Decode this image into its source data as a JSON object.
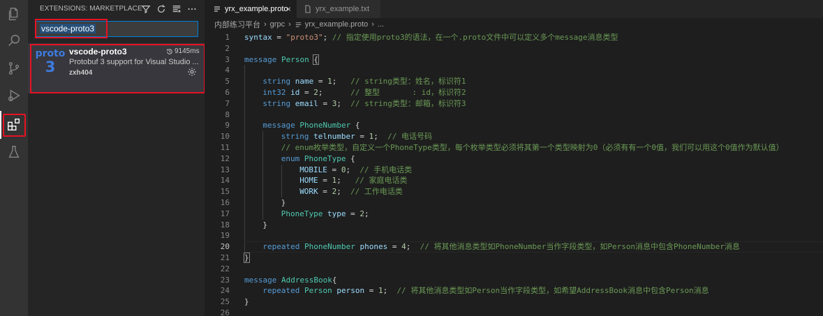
{
  "sidebar": {
    "title": "EXTENSIONS: MARKETPLACE",
    "search_value": "vscode-proto3",
    "extension": {
      "logo_line1": "proto",
      "logo_line2": "3",
      "name": "vscode-proto3",
      "installs": "9145ms",
      "description": "Protobuf 3 support for Visual Studio ...",
      "author": "zxh404"
    }
  },
  "tabs": [
    {
      "label": "yrx_example.proto",
      "close": "×"
    },
    {
      "label": "yrx_example.txt"
    }
  ],
  "breadcrumb": [
    "内部练习平台",
    "grpc",
    "yrx_example.proto",
    "..."
  ],
  "code": {
    "current_line": 20,
    "lines": [
      {
        "n": "1"
      },
      {
        "n": "2"
      },
      {
        "n": "3"
      },
      {
        "n": "4"
      },
      {
        "n": "5"
      },
      {
        "n": "6"
      },
      {
        "n": "7"
      },
      {
        "n": "8"
      },
      {
        "n": "9"
      },
      {
        "n": "10"
      },
      {
        "n": "11"
      },
      {
        "n": "12"
      },
      {
        "n": "13"
      },
      {
        "n": "14"
      },
      {
        "n": "15"
      },
      {
        "n": "16"
      },
      {
        "n": "17"
      },
      {
        "n": "18"
      },
      {
        "n": "19"
      },
      {
        "n": "20"
      },
      {
        "n": "21"
      },
      {
        "n": "22"
      },
      {
        "n": "23"
      },
      {
        "n": "24"
      },
      {
        "n": "25"
      },
      {
        "n": "26"
      }
    ],
    "tokens": {
      "l1": [
        "syntax",
        " = ",
        "\"proto3\"",
        "; ",
        "// 指定使用proto3的语法，在一个.proto文件中可以定义多个message消息类型"
      ],
      "l3": [
        "message",
        " ",
        "Person",
        " ",
        "{"
      ],
      "l5": [
        "string",
        " ",
        "name",
        " = ",
        "1",
        ";   ",
        "// string类型：姓名，标识符1"
      ],
      "l6": [
        "int32",
        " ",
        "id",
        " = ",
        "2",
        ";      ",
        "// 整型       : id，标识符2"
      ],
      "l7": [
        "string",
        " ",
        "email",
        " = ",
        "3",
        ";  ",
        "// string类型：邮箱，标识符3"
      ],
      "l9": [
        "message",
        " ",
        "PhoneNumber",
        " {"
      ],
      "l10": [
        "string",
        " ",
        "telnumber",
        " = ",
        "1",
        ";  ",
        "// 电话号码"
      ],
      "l11": [
        "// enum枚举类型，自定义一个PhoneType类型，每个枚举类型必须将其第一个类型映射为0（必须有有一个0值，我们可以用这个0值作为默认值）"
      ],
      "l12": [
        "enum",
        " ",
        "PhoneType",
        " {"
      ],
      "l13": [
        "MOBILE",
        " = ",
        "0",
        ";  ",
        "// 手机电话类"
      ],
      "l14": [
        "HOME",
        " = ",
        "1",
        ";   ",
        "// 家庭电话类"
      ],
      "l15": [
        "WORK",
        " = ",
        "2",
        ";  ",
        "// 工作电话类"
      ],
      "l16": [
        "}"
      ],
      "l17": [
        "PhoneType",
        " ",
        "type",
        " = ",
        "2",
        ";"
      ],
      "l18": [
        "}"
      ],
      "l20": [
        "repeated",
        " ",
        "PhoneNumber",
        " ",
        "phones",
        " = ",
        "4",
        ";  ",
        "// 将其他消息类型如PhoneNumber当作字段类型，如Person消息中包含PhoneNumber消息"
      ],
      "l21": [
        "}"
      ],
      "l23": [
        "message",
        " ",
        "AddressBook",
        "{"
      ],
      "l24": [
        "repeated",
        " ",
        "Person",
        " ",
        "person",
        " = ",
        "1",
        ";  ",
        "// 将其他消息类型如Person当作字段类型，如希望AddressBook消息中包含Person消息"
      ],
      "l25": [
        "}"
      ]
    }
  },
  "colors": {
    "keyword": "#569cd6",
    "type": "#4ec9b0",
    "variable": "#9cdcfe",
    "number": "#b5cea8",
    "string": "#ce9178",
    "comment": "#6a9955",
    "highlight_box": "#e81123"
  },
  "icons": {
    "activity": [
      "files-icon",
      "search-icon",
      "source-control-icon",
      "run-debug-icon",
      "extensions-icon",
      "testing-flask-icon"
    ],
    "sidebar_actions": [
      "filter-icon",
      "refresh-icon",
      "clear-icon",
      "more-icon"
    ]
  }
}
